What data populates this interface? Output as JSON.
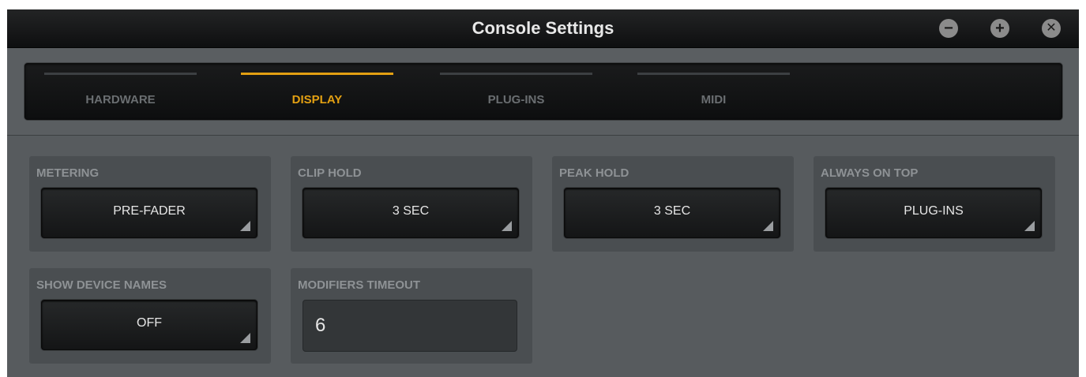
{
  "window": {
    "title": "Console Settings",
    "controls": {
      "minimize": "−",
      "maximize": "+",
      "close": "✕"
    }
  },
  "tabs": [
    {
      "label": "HARDWARE",
      "active": false
    },
    {
      "label": "DISPLAY",
      "active": true
    },
    {
      "label": "PLUG-INS",
      "active": false
    },
    {
      "label": "MIDI",
      "active": false
    }
  ],
  "settings": {
    "metering": {
      "label": "METERING",
      "value": "PRE-FADER"
    },
    "clip_hold": {
      "label": "CLIP HOLD",
      "value": "3 SEC"
    },
    "peak_hold": {
      "label": "PEAK HOLD",
      "value": "3 SEC"
    },
    "always_on_top": {
      "label": "ALWAYS ON TOP",
      "value": "PLUG-INS"
    },
    "show_device_names": {
      "label": "SHOW DEVICE NAMES",
      "value": "OFF"
    },
    "modifiers_timeout": {
      "label": "MODIFIERS TIMEOUT",
      "value": "6"
    }
  },
  "colors": {
    "accent": "#e3a012",
    "window_bg": "#575b5e",
    "panel_bg": "#4a4e51"
  },
  "icons": {
    "minimize": "minus-circle-icon",
    "maximize": "plus-circle-icon",
    "close": "close-circle-icon",
    "dropdown": "dropdown-corner-icon"
  }
}
